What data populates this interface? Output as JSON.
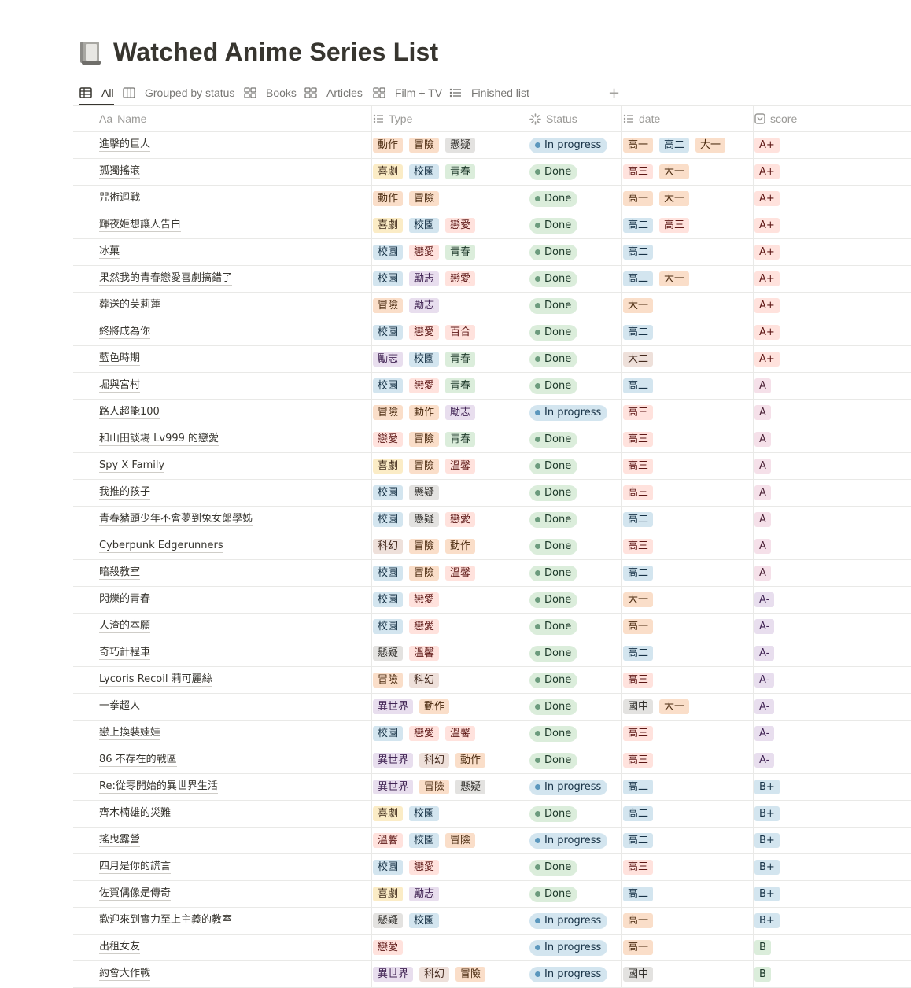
{
  "page": {
    "title": "Watched Anime Series List",
    "icon": "book-icon"
  },
  "tabs": [
    {
      "label": "All",
      "icon": "table-icon",
      "active": true
    },
    {
      "label": "Grouped by status",
      "icon": "board-icon",
      "active": false
    },
    {
      "label": "Books",
      "icon": "gallery-icon",
      "active": false
    },
    {
      "label": "Articles",
      "icon": "gallery-icon",
      "active": false
    },
    {
      "label": "Film + TV",
      "icon": "gallery-icon",
      "active": false
    },
    {
      "label": "Finished list",
      "icon": "list-icon",
      "active": false
    }
  ],
  "add_view_label": "+",
  "columns": {
    "name": {
      "label": "Name",
      "icon_text": "Aa"
    },
    "type": {
      "label": "Type",
      "icon": "multi-select-icon"
    },
    "status": {
      "label": "Status",
      "icon": "status-icon"
    },
    "date": {
      "label": "date",
      "icon": "multi-select-icon"
    },
    "score": {
      "label": "score",
      "icon": "select-icon"
    }
  },
  "status_colors": {
    "Done": "#dbeddb",
    "In progress": "#d3e5ef"
  },
  "rows": [
    {
      "name": "進擊的巨人",
      "types": [
        "動作",
        "冒險",
        "懸疑"
      ],
      "status": "In progress",
      "dates": [
        "高一",
        "高二",
        "大一"
      ],
      "score": "A+"
    },
    {
      "name": "孤獨搖滾",
      "types": [
        "喜劇",
        "校園",
        "青春"
      ],
      "status": "Done",
      "dates": [
        "高三",
        "大一"
      ],
      "score": "A+"
    },
    {
      "name": "咒術迴戰",
      "types": [
        "動作",
        "冒險"
      ],
      "status": "Done",
      "dates": [
        "高一",
        "大一"
      ],
      "score": "A+"
    },
    {
      "name": "輝夜姬想讓人告白",
      "types": [
        "喜劇",
        "校園",
        "戀愛"
      ],
      "status": "Done",
      "dates": [
        "高二",
        "高三"
      ],
      "score": "A+"
    },
    {
      "name": "冰菓",
      "types": [
        "校園",
        "戀愛",
        "青春"
      ],
      "status": "Done",
      "dates": [
        "高二"
      ],
      "score": "A+"
    },
    {
      "name": "果然我的青春戀愛喜劇搞錯了",
      "types": [
        "校園",
        "勵志",
        "戀愛"
      ],
      "status": "Done",
      "dates": [
        "高二",
        "大一"
      ],
      "score": "A+"
    },
    {
      "name": "葬送的芙莉蓮",
      "types": [
        "冒險",
        "勵志"
      ],
      "status": "Done",
      "dates": [
        "大一"
      ],
      "score": "A+"
    },
    {
      "name": "終將成為你",
      "types": [
        "校園",
        "戀愛",
        "百合"
      ],
      "status": "Done",
      "dates": [
        "高二"
      ],
      "score": "A+"
    },
    {
      "name": "藍色時期",
      "types": [
        "勵志",
        "校園",
        "青春"
      ],
      "status": "Done",
      "dates": [
        "大二"
      ],
      "score": "A+"
    },
    {
      "name": "堀與宮村",
      "types": [
        "校園",
        "戀愛",
        "青春"
      ],
      "status": "Done",
      "dates": [
        "高二"
      ],
      "score": "A"
    },
    {
      "name": "路人超能100",
      "types": [
        "冒險",
        "動作",
        "勵志"
      ],
      "status": "In progress",
      "dates": [
        "高三"
      ],
      "score": "A"
    },
    {
      "name": "和山田談場 Lv999 的戀愛",
      "types": [
        "戀愛",
        "冒險",
        "青春"
      ],
      "status": "Done",
      "dates": [
        "高三"
      ],
      "score": "A"
    },
    {
      "name": "Spy X Family",
      "types": [
        "喜劇",
        "冒險",
        "溫馨"
      ],
      "status": "Done",
      "dates": [
        "高三"
      ],
      "score": "A"
    },
    {
      "name": "我推的孩子",
      "types": [
        "校園",
        "懸疑"
      ],
      "status": "Done",
      "dates": [
        "高三"
      ],
      "score": "A"
    },
    {
      "name": "青春豬頭少年不會夢到兔女郎學姊",
      "types": [
        "校園",
        "懸疑",
        "戀愛"
      ],
      "status": "Done",
      "dates": [
        "高二"
      ],
      "score": "A"
    },
    {
      "name": "Cyberpunk Edgerunners",
      "types": [
        "科幻",
        "冒險",
        "動作"
      ],
      "status": "Done",
      "dates": [
        "高三"
      ],
      "score": "A"
    },
    {
      "name": "暗殺教室",
      "types": [
        "校園",
        "冒險",
        "溫馨"
      ],
      "status": "Done",
      "dates": [
        "高二"
      ],
      "score": "A"
    },
    {
      "name": "閃爍的青春",
      "types": [
        "校園",
        "戀愛"
      ],
      "status": "Done",
      "dates": [
        "大一"
      ],
      "score": "A-"
    },
    {
      "name": "人渣的本願",
      "types": [
        "校園",
        "戀愛"
      ],
      "status": "Done",
      "dates": [
        "高一"
      ],
      "score": "A-"
    },
    {
      "name": "奇巧計程車",
      "types": [
        "懸疑",
        "溫馨"
      ],
      "status": "Done",
      "dates": [
        "高二"
      ],
      "score": "A-"
    },
    {
      "name": "Lycoris Recoil 莉可麗絲",
      "types": [
        "冒險",
        "科幻"
      ],
      "status": "Done",
      "dates": [
        "高三"
      ],
      "score": "A-"
    },
    {
      "name": "一拳超人",
      "types": [
        "異世界",
        "動作"
      ],
      "status": "Done",
      "dates": [
        "國中",
        "大一"
      ],
      "score": "A-"
    },
    {
      "name": "戀上換裝娃娃",
      "types": [
        "校園",
        "戀愛",
        "溫馨"
      ],
      "status": "Done",
      "dates": [
        "高三"
      ],
      "score": "A-"
    },
    {
      "name": "86 不存在的戰區",
      "types": [
        "異世界",
        "科幻",
        "動作"
      ],
      "status": "Done",
      "dates": [
        "高三"
      ],
      "score": "A-"
    },
    {
      "name": "Re:從零開始的異世界生活",
      "types": [
        "異世界",
        "冒險",
        "懸疑"
      ],
      "status": "In progress",
      "dates": [
        "高二"
      ],
      "score": "B+"
    },
    {
      "name": "齊木楠雄的災難",
      "types": [
        "喜劇",
        "校園"
      ],
      "status": "Done",
      "dates": [
        "高二"
      ],
      "score": "B+"
    },
    {
      "name": "搖曳露營",
      "types": [
        "溫馨",
        "校園",
        "冒險"
      ],
      "status": "In progress",
      "dates": [
        "高二"
      ],
      "score": "B+"
    },
    {
      "name": "四月是你的謊言",
      "types": [
        "校園",
        "戀愛"
      ],
      "status": "Done",
      "dates": [
        "高三"
      ],
      "score": "B+"
    },
    {
      "name": "佐賀偶像是傳奇",
      "types": [
        "喜劇",
        "勵志"
      ],
      "status": "Done",
      "dates": [
        "高二"
      ],
      "score": "B+"
    },
    {
      "name": "歡迎來到實力至上主義的教室",
      "types": [
        "懸疑",
        "校園"
      ],
      "status": "In progress",
      "dates": [
        "高一"
      ],
      "score": "B+"
    },
    {
      "name": "出租女友",
      "types": [
        "戀愛"
      ],
      "status": "In progress",
      "dates": [
        "高一"
      ],
      "score": "B"
    },
    {
      "name": "約會大作戰",
      "types": [
        "異世界",
        "科幻",
        "冒險"
      ],
      "status": "In progress",
      "dates": [
        "國中"
      ],
      "score": "B"
    }
  ]
}
